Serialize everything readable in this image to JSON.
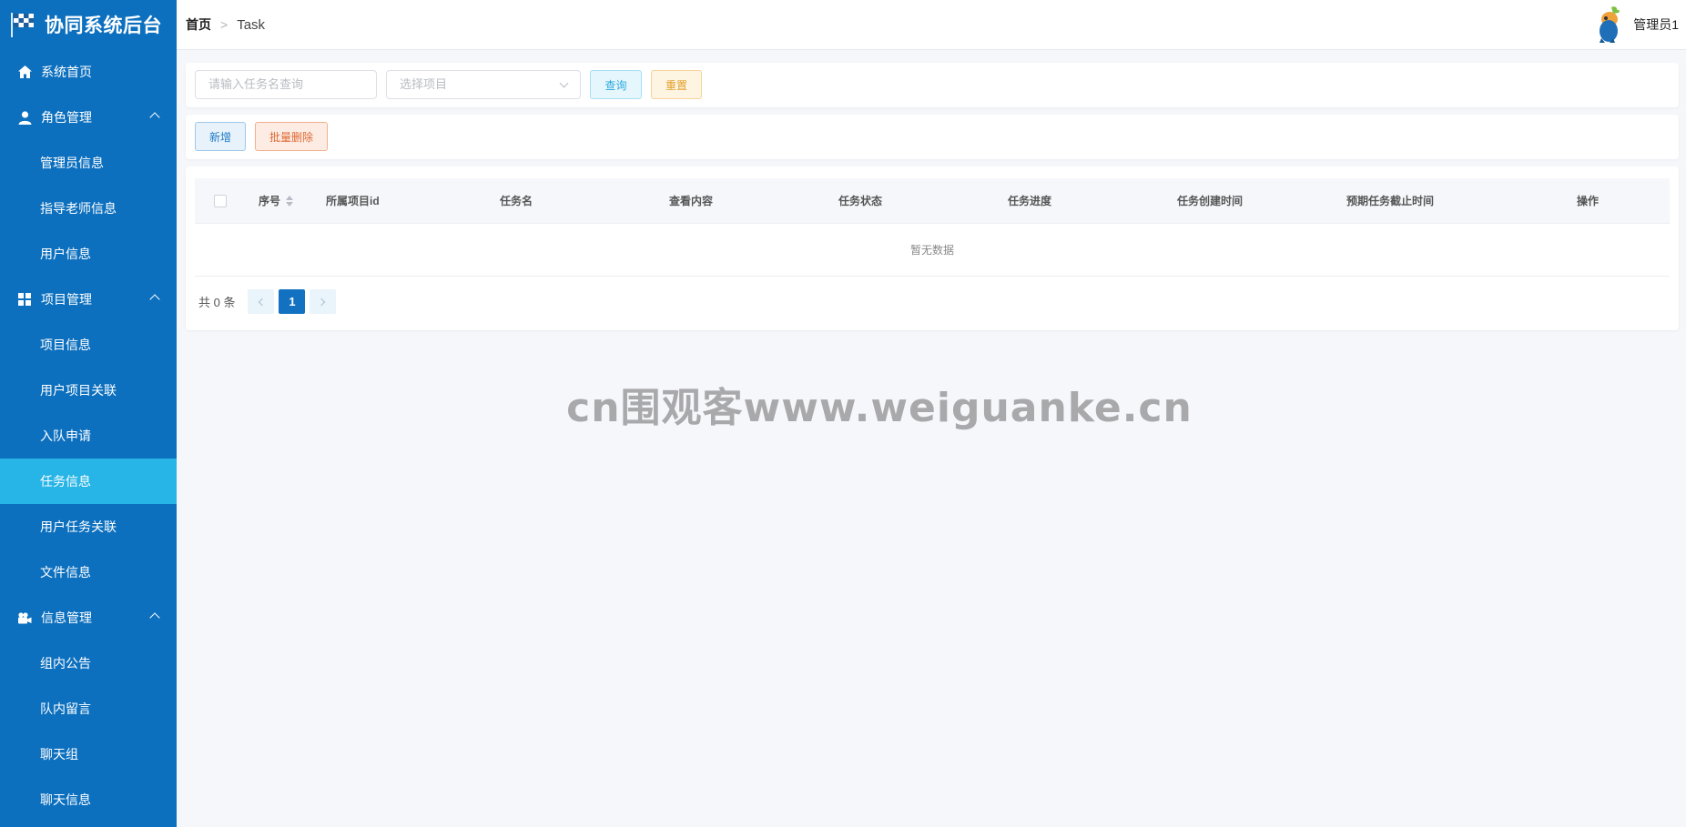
{
  "app": {
    "title": "协同系统后台"
  },
  "sidebar": {
    "items": [
      {
        "label": "系统首页",
        "icon": "home-icon",
        "type": "top"
      },
      {
        "label": "角色管理",
        "icon": "user-icon",
        "type": "group"
      },
      {
        "label": "管理员信息",
        "type": "sub"
      },
      {
        "label": "指导老师信息",
        "type": "sub"
      },
      {
        "label": "用户信息",
        "type": "sub"
      },
      {
        "label": "项目管理",
        "icon": "grid-icon",
        "type": "group"
      },
      {
        "label": "项目信息",
        "type": "sub"
      },
      {
        "label": "用户项目关联",
        "type": "sub"
      },
      {
        "label": "入队申请",
        "type": "sub"
      },
      {
        "label": "任务信息",
        "type": "sub",
        "active": true
      },
      {
        "label": "用户任务关联",
        "type": "sub"
      },
      {
        "label": "文件信息",
        "type": "sub"
      },
      {
        "label": "信息管理",
        "icon": "camera-icon",
        "type": "group"
      },
      {
        "label": "组内公告",
        "type": "sub"
      },
      {
        "label": "队内留言",
        "type": "sub"
      },
      {
        "label": "聊天组",
        "type": "sub"
      },
      {
        "label": "聊天信息",
        "type": "sub"
      }
    ]
  },
  "header": {
    "breadcrumb": {
      "home": "首页",
      "current": "Task"
    },
    "user": {
      "name": "管理员1"
    }
  },
  "search": {
    "task_placeholder": "请输入任务名查询",
    "project_placeholder": "选择项目",
    "query_label": "查询",
    "reset_label": "重置"
  },
  "operations": {
    "add_label": "新增",
    "batch_delete_label": "批量删除"
  },
  "table": {
    "columns": [
      "序号",
      "所属项目id",
      "任务名",
      "查看内容",
      "任务状态",
      "任务进度",
      "任务创建时间",
      "预期任务截止时间",
      "操作"
    ],
    "empty_text": "暂无数据"
  },
  "pagination": {
    "total_text": "共 0 条",
    "current_page": "1"
  },
  "watermark": "cn围观客www.weiguanke.cn",
  "colors": {
    "sidebar": "#0d70bf",
    "active_item": "#27b4e6",
    "page_bg": "#f6f7fb"
  }
}
